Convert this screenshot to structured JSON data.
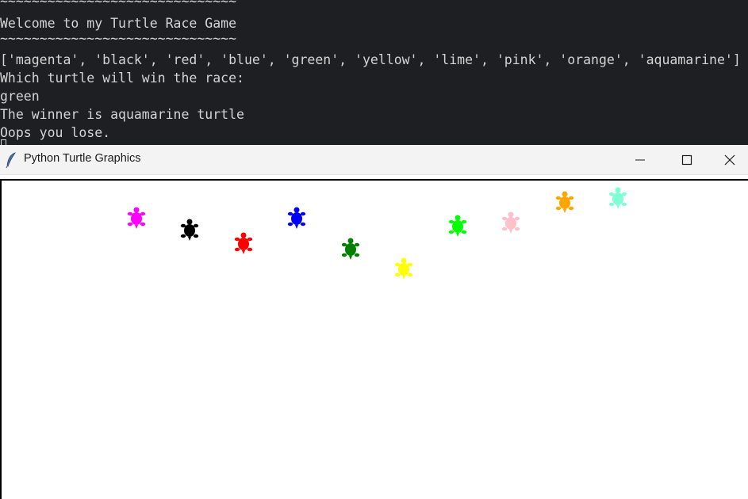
{
  "terminal": {
    "lines": [
      "~~~~~~~~~~~~~~~~~~~~~~~~~~~~~~",
      "Welcome to my Turtle Race Game",
      "~~~~~~~~~~~~~~~~~~~~~~~~~~~~~~",
      "['magenta', 'black', 'red', 'blue', 'green', 'yellow', 'lime', 'pink', 'orange', 'aquamarine']",
      "Which turtle will win the race:",
      "green",
      "The winner is aquamarine turtle",
      "Oops you lose."
    ]
  },
  "window": {
    "title": "Python Turtle Graphics",
    "icon": "feather-icon",
    "controls": [
      "minimize-icon",
      "maximize-icon",
      "close-icon"
    ]
  },
  "race": {
    "turtles": [
      {
        "color": "#ff00ff",
        "name": "magenta"
      },
      {
        "color": "#000000",
        "name": "black"
      },
      {
        "color": "#ff0000",
        "name": "red"
      },
      {
        "color": "#0000ff",
        "name": "blue"
      },
      {
        "color": "#008000",
        "name": "green"
      },
      {
        "color": "#ffff00",
        "name": "yellow"
      },
      {
        "color": "#00ff00",
        "name": "lime"
      },
      {
        "color": "#ffc0cb",
        "name": "pink"
      },
      {
        "color": "#ffa500",
        "name": "orange"
      },
      {
        "color": "#7fffd4",
        "name": "aquamarine"
      }
    ]
  }
}
